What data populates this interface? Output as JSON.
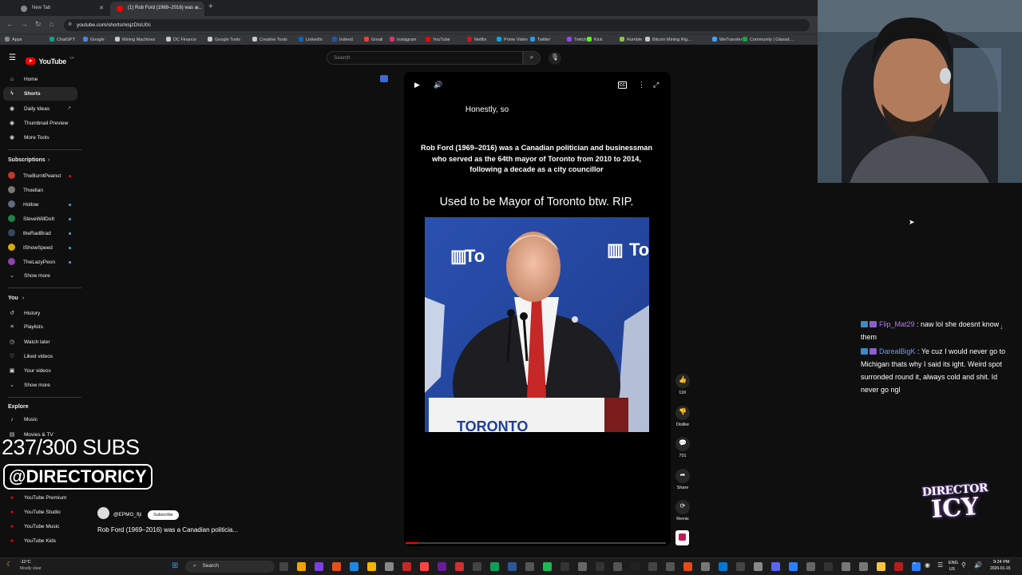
{
  "browser": {
    "tabs": [
      {
        "title": "New Tab",
        "active": false
      },
      {
        "title": "(1) Rob Ford (1969–2016) was a…",
        "active": true
      }
    ],
    "url": "youtube.com/shorts/nisjzDIsU0c",
    "bookmarks": [
      "Apps",
      "ChatGPT",
      "Google",
      "Mining Machines",
      "DC Finance",
      "Google Tools",
      "Creative Tools",
      "LinkedIn",
      "Indeed",
      "Gmail",
      "Instagram",
      "YouTube",
      "Netflix",
      "Prime Video",
      "Twitter",
      "Twitch",
      "Kick",
      "Rumble",
      "Bitcoin Mining Rig…",
      "WeTransfer",
      "Community | Glassd…"
    ]
  },
  "youtube": {
    "logo_text": "YouTube",
    "country": "CA",
    "search_placeholder": "Search",
    "sidebar": {
      "main": [
        {
          "label": "Home",
          "icon": "home-icon"
        },
        {
          "label": "Shorts",
          "icon": "shorts-icon"
        },
        {
          "label": "Daily Ideas",
          "icon": "circle-icon"
        },
        {
          "label": "Thumbnail Preview",
          "icon": "circle-icon"
        },
        {
          "label": "More Tools",
          "icon": "circle-icon"
        }
      ],
      "subscriptions_title": "Subscriptions",
      "subscriptions": [
        "TheBurntPeanut",
        "Thoelian",
        "Hollow",
        "SteveWillDoIt",
        "theRadBrad",
        "IShowSpeed",
        "TheLazyPeon"
      ],
      "show_more": "Show more",
      "you_title": "You",
      "you": [
        "History",
        "Playlists",
        "Watch later",
        "Liked videos",
        "Your videos"
      ],
      "explore_title": "Explore",
      "explore": [
        "Music",
        "Movies & TV"
      ],
      "more_from": [
        "YouTube Premium",
        "YouTube Studio",
        "YouTube Music",
        "YouTube Kids"
      ]
    },
    "short": {
      "caption_top": "Honestly, so",
      "caption_fact": "Rob Ford (1969–2016) was a Canadian politician and businessman who served as the 64th mayor of Toronto from 2010 to 2014, following a decade as a city councillor",
      "caption_bottom": "Used to be Mayor of Toronto btw. RIP.",
      "podium_text": "TORONTO",
      "backdrop_text": "To",
      "channel": "@EPMG_fiji",
      "subscribe_label": "Subscribe",
      "title": "Rob Ford (1969–2016) was a Canadian politicia...",
      "progress": 0.05
    },
    "actions": [
      {
        "label": "11K",
        "icon": "like-icon"
      },
      {
        "label": "Dislike",
        "icon": "dislike-icon"
      },
      {
        "label": "701",
        "icon": "comment-icon"
      },
      {
        "label": "Share",
        "icon": "share-icon"
      },
      {
        "label": "Remix",
        "icon": "remix-icon"
      }
    ]
  },
  "overlay": {
    "subs": "237/300 SUBS",
    "handle": "@DIRECTORICY",
    "logo_top": "DIRECTOR",
    "logo_bottom": "ICY"
  },
  "chat": [
    {
      "user": "Flip_Mat29",
      "color": "#b67cf2",
      "message": "naw lol she doesnt know them"
    },
    {
      "user": "DarealBigK",
      "color": "#6e9cff",
      "message": "Ye cuz I would never go to Michigan thats why I said its ight. Weird spot surronded round it, always cold and shit. Id never go ngl"
    }
  ],
  "taskbar": {
    "weather_temp": "-11°C",
    "weather_desc": "Mostly clear",
    "search": "Search",
    "lang": "ENG",
    "region": "US",
    "time": "9:24 PM",
    "date": "2026-01-15"
  }
}
